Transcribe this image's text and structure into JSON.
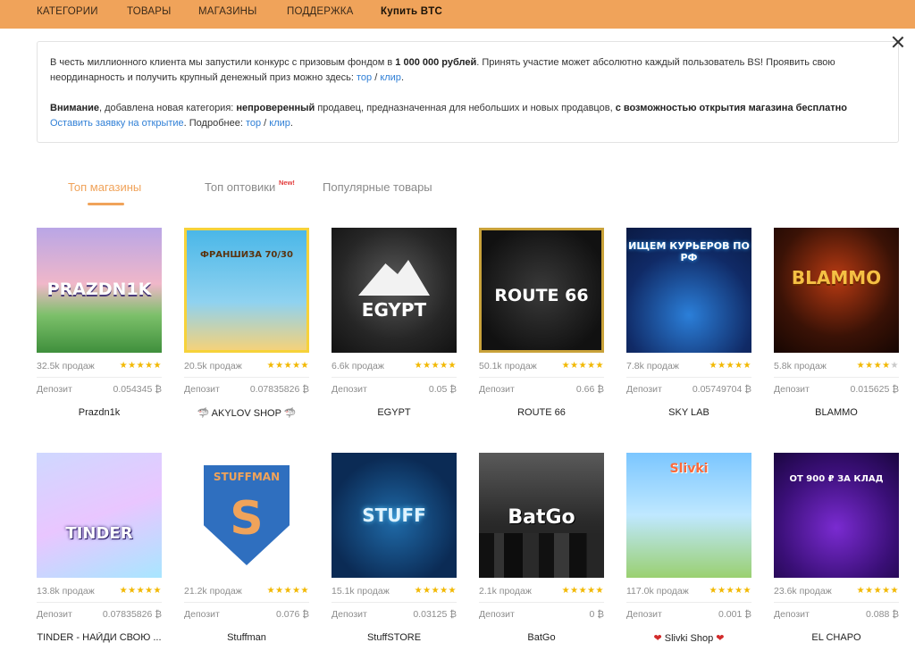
{
  "nav": {
    "items": [
      "КАТЕГОРИИ",
      "ТОВАРЫ",
      "МАГАЗИНЫ",
      "ПОДДЕРЖКА"
    ],
    "buy_label": "Купить BTC"
  },
  "notice": {
    "line1_a": "В честь миллионного клиента мы запустили конкурс с призовым фондом в ",
    "line1_b": "1 000 000 рублей",
    "line1_c": ". Принять участие может абсолютно каждый пользователь BS! Проявить свою",
    "line2_a": "неординарность и получить крупный денежный приз можно здесь: ",
    "link_tor": "тор",
    "slash": " / ",
    "link_clip": "клир",
    "dot": ".",
    "line3_a": "Внимание",
    "line3_b": ", добавлена новая категория: ",
    "line3_c": "непроверенный",
    "line3_d": " продавец, предназначенная для небольших и новых продавцов, ",
    "line3_e": "с возможностью открытия магазина бесплатно",
    "line4_link": "Оставить заявку на открытие",
    "line4_b": ". Подробнее: "
  },
  "tabs": {
    "top_shops": "Топ магазины",
    "top_wholesale": "Топ оптовики",
    "new_badge": "New!",
    "popular": "Популярные товары"
  },
  "labels": {
    "deposit": "Депозит",
    "stars": "★★★★★"
  },
  "shops": [
    {
      "name": "Prazdn1k",
      "sales": "32.5k продаж",
      "deposit": "0.054345 ₿",
      "thumb_text": "PRAZDN1K",
      "rating": 5
    },
    {
      "name": "AKYLOV SHOP",
      "sales": "20.5k продаж",
      "deposit": "0.07835826 ₿",
      "thumb_text": "ФРАНШИЗА 70/30",
      "rating": 5
    },
    {
      "name": "EGYPT",
      "sales": "6.6k продаж",
      "deposit": "0.05 ₿",
      "thumb_text": "EGYPT",
      "rating": 5
    },
    {
      "name": "ROUTE 66",
      "sales": "50.1k продаж",
      "deposit": "0.66 ₿",
      "thumb_text": "ROUTE 66",
      "rating": 5
    },
    {
      "name": "SKY LAB",
      "sales": "7.8k продаж",
      "deposit": "0.05749704 ₿",
      "thumb_text": "ИЩЕМ КУРЬЕРОВ ПО РФ",
      "rating": 5
    },
    {
      "name": "BLAMMO",
      "sales": "5.8k продаж",
      "deposit": "0.015625 ₿",
      "thumb_text": "BLAMMO",
      "rating": 4.5
    },
    {
      "name": "TINDER - НАЙДИ СВОЮ ...",
      "sales": "13.8k продаж",
      "deposit": "0.07835826 ₿",
      "thumb_text": "TINDER",
      "rating": 5
    },
    {
      "name": "Stuffman",
      "sales": "21.2k продаж",
      "deposit": "0.076 ₿",
      "thumb_text": "STUFFMAN",
      "rating": 5
    },
    {
      "name": "StuffSTORE",
      "sales": "15.1k продаж",
      "deposit": "0.03125 ₿",
      "thumb_text": "STUFF",
      "rating": 5
    },
    {
      "name": "BatGo",
      "sales": "2.1k продаж",
      "deposit": "0 ₿",
      "thumb_text": "BatGo",
      "rating": 5
    },
    {
      "name": "Slivki Shop",
      "sales": "117.0k продаж",
      "deposit": "0.001 ₿",
      "thumb_text": "Slivki",
      "rating": 5
    },
    {
      "name": "EL CHAPO",
      "sales": "23.6k продаж",
      "deposit": "0.088 ₿",
      "thumb_text": "OT 900 ₽ ЗА КЛАД",
      "rating": 5
    }
  ],
  "colors": {
    "accent": "#f0a35a",
    "link": "#2f7fd6",
    "star": "#f2b800"
  }
}
